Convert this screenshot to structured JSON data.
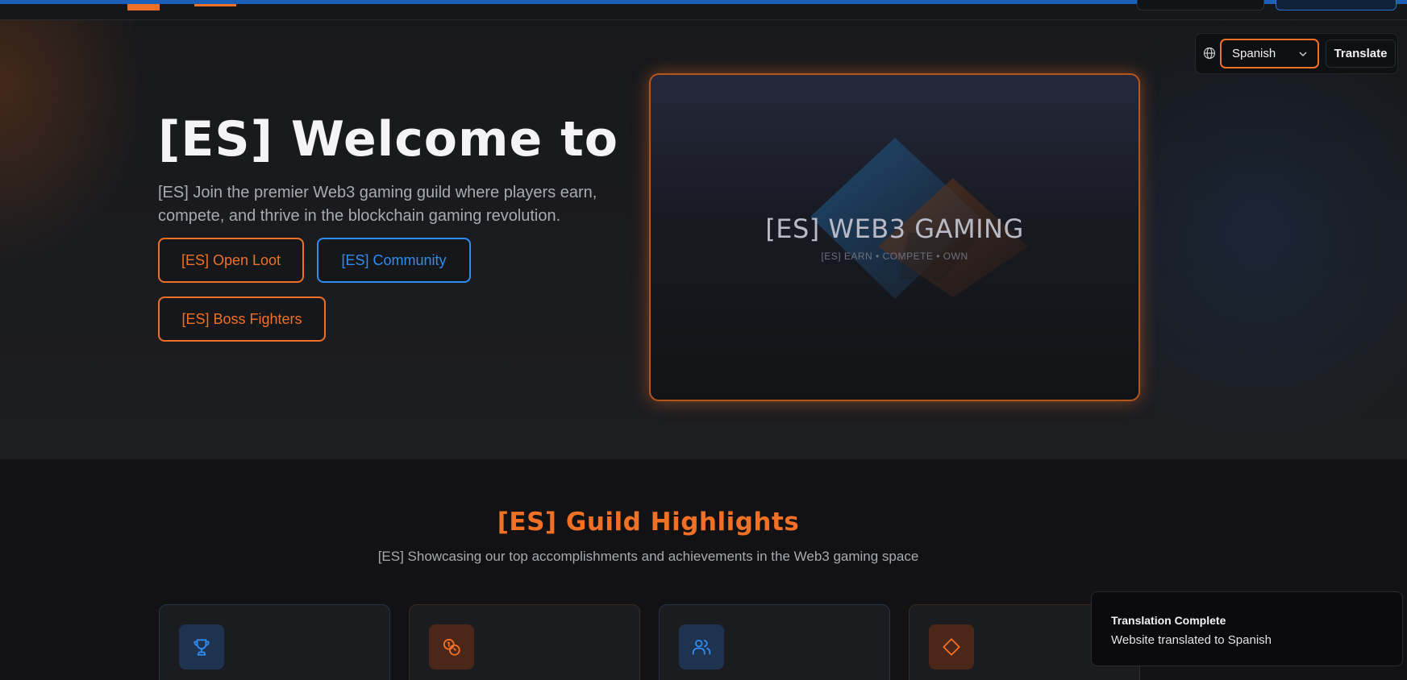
{
  "hero": {
    "title": "[ES] Welcome to",
    "subtitle": "[ES] Join the premier Web3 gaming guild where players earn, compete, and thrive in the blockchain gaming revolution.",
    "buttons": {
      "open_loot": "[ES] Open Loot",
      "community": "[ES] Community",
      "boss_fighters": "[ES] Boss Fighters"
    },
    "card": {
      "title": "[ES] WEB3 GAMING",
      "tagline": "[ES] EARN • COMPETE • OWN"
    }
  },
  "translate": {
    "icon": "globe-icon",
    "selected_language": "Spanish",
    "button_label": "Translate"
  },
  "highlights": {
    "title": "[ES] Guild Highlights",
    "subtitle": "[ES] Showcasing our top accomplishments and achievements in the Web3 gaming space",
    "cards": [
      {
        "icon": "trophy-icon",
        "accent": "#2f8cf0"
      },
      {
        "icon": "coins-icon",
        "accent": "#f07026"
      },
      {
        "icon": "users-icon",
        "accent": "#2f8cf0"
      },
      {
        "icon": "diamond-icon",
        "accent": "#f07026"
      }
    ]
  },
  "toast": {
    "title": "Translation Complete",
    "description": "Website translated to Spanish"
  },
  "colors": {
    "accent_orange": "#f07026",
    "accent_blue": "#2f8cf0",
    "background": "#121214"
  }
}
